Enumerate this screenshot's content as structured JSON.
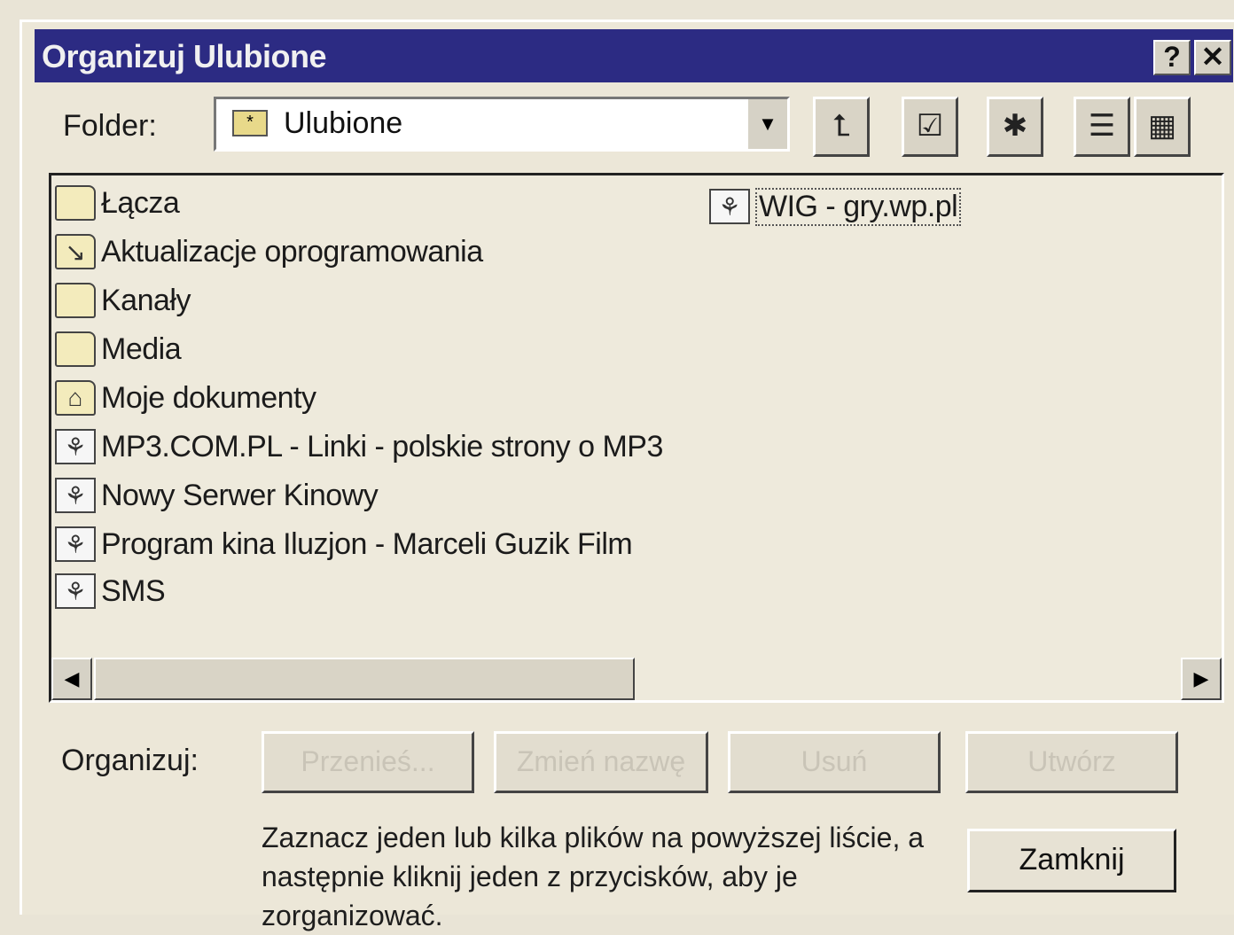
{
  "window": {
    "title": "Organizuj Ulubione",
    "help_label": "?",
    "close_label": "✕"
  },
  "folder": {
    "label": "Folder:",
    "selected": "Ulubione",
    "dropdown_arrow": "▼"
  },
  "toolbar": {
    "icons": [
      "up-folder-icon",
      "properties-icon",
      "new-folder-icon",
      "list-view-icon",
      "details-view-icon"
    ]
  },
  "list": {
    "items": [
      {
        "label": "Łącza",
        "type": "folder"
      },
      {
        "label": "Aktualizacje oprogramowania",
        "type": "folder"
      },
      {
        "label": "Kanały",
        "type": "folder"
      },
      {
        "label": "Media",
        "type": "folder"
      },
      {
        "label": "Moje dokumenty",
        "type": "folder"
      },
      {
        "label": "MP3.COM.PL - Linki - polskie strony o MP3",
        "type": "link"
      },
      {
        "label": "Nowy Serwer Kinowy",
        "type": "link"
      },
      {
        "label": "Program kina Iluzjon - Marceli Guzik Film",
        "type": "link"
      },
      {
        "label": "SMS",
        "type": "link"
      }
    ],
    "column2": [
      {
        "label": "WIG - gry.wp.pl",
        "type": "link"
      }
    ]
  },
  "organize": {
    "label": "Organizuj:",
    "buttons": [
      "Przenieś...",
      "Zmień nazwę",
      "Usuń",
      "Utwórz"
    ]
  },
  "help_text": "Zaznacz jeden lub kilka plików na powyższej liście, a następnie kliknij jeden z przycisków, aby je zorganizować.",
  "close_button": "Zamknij"
}
